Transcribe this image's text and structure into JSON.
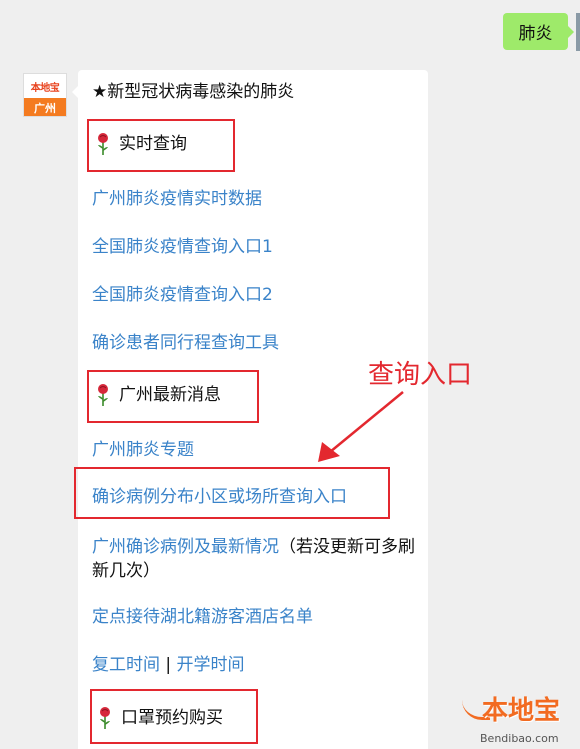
{
  "outgoing": {
    "text": "肺炎"
  },
  "avatar": {
    "top_text": "本地宝",
    "bottom_text": "广州"
  },
  "message": {
    "title": "★新型冠状病毒感染的肺炎",
    "sections": {
      "realtime": "实时查询",
      "latest": "广州最新消息",
      "mask": "口罩预约购买"
    },
    "links": {
      "gz_data": "广州肺炎疫情实时数据",
      "national_1": "全国肺炎疫情查询入口1",
      "national_2": "全国肺炎疫情查询入口2",
      "same_trip": "确诊患者同行程查询工具",
      "gz_topic": "广州肺炎专题",
      "community": "确诊病例分布小区或场所查询入口",
      "gz_cases": "广州确诊病例及最新情况",
      "gz_cases_note": "（若没更新可多刷新几次）",
      "hotels": "定点接待湖北籍游客酒店名单",
      "work": "复工时间",
      "separator": " | ",
      "school": "开学时间"
    }
  },
  "annotation": {
    "text": "查询入口"
  },
  "watermark": {
    "logo": "本地宝",
    "url": "Bendibao.com"
  },
  "colors": {
    "link": "#3a83c9",
    "highlight": "#e3282f",
    "outgoing_bubble": "#9eea6a",
    "brand": "#f26b21"
  }
}
